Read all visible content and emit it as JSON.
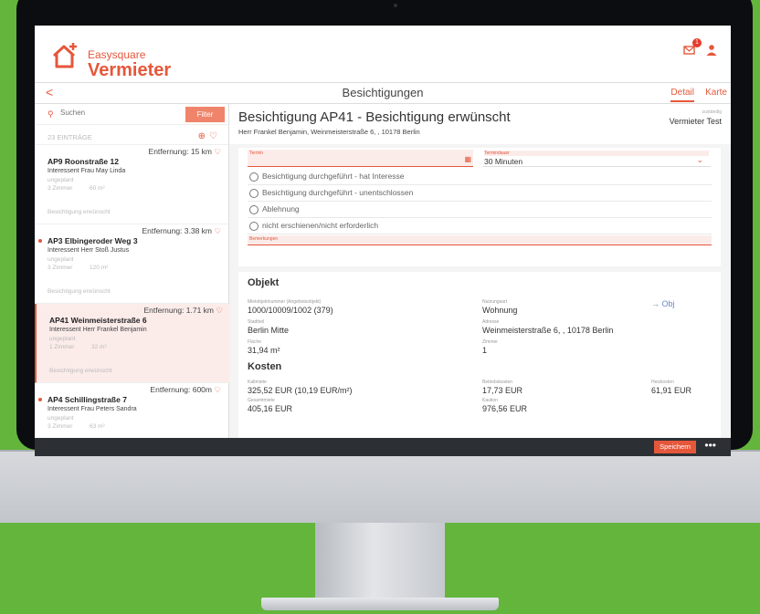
{
  "header": {
    "brand_top": "Easysquare",
    "brand_main": "Vermieter",
    "notification_count": "1"
  },
  "titlebar": {
    "back": "<",
    "title": "Besichtigungen",
    "tab_detail": "Detail",
    "tab_karte": "Karte"
  },
  "sidebar": {
    "search_placeholder": "Suchen",
    "filter_label": "Filter",
    "entries_count": "23 EINTRÄGE",
    "items": [
      {
        "distance": "Entfernung: 15 km",
        "title": "AP9 Roonstraße 12",
        "subtitle": "Interessent Frau May Linda",
        "plan": "ungeplant",
        "rooms": "3 Zimmer",
        "area": "60 m²",
        "status": "Besichtigung erwünscht"
      },
      {
        "distance": "Entfernung: 3.38 km",
        "title": "AP3 Elbingeroder Weg 3",
        "subtitle": "Interessent Herr Stoß Justus",
        "plan": "ungeplant",
        "rooms": "3 Zimmer",
        "area": "120 m²",
        "status": "Besichtigung erwünscht"
      },
      {
        "distance": "Entfernung: 1.71 km",
        "title": "AP41 Weinmeisterstraße 6",
        "subtitle": "Interessent Herr Frankel Benjamin",
        "plan": "ungeplant",
        "rooms": "1 Zimmer",
        "area": "32 m²",
        "status": "Besichtigung erwünscht"
      },
      {
        "distance": "Entfernung: 600m",
        "title": "AP4 Schillingstraße 7",
        "subtitle": "Interessent Frau Peters Sandra",
        "plan": "ungeplant",
        "rooms": "3 Zimmer",
        "area": "63 m²",
        "status": ""
      }
    ]
  },
  "detail": {
    "title": "Besichtigung AP41 - Besichtigung erwünscht",
    "subtitle": "Herr Frankel Benjamin, Weinmeisterstraße 6, , 10178 Berlin",
    "zustaendig_label": "zuständig",
    "zustaendig_value": "Vermieter Test",
    "termin_label": "Termin",
    "dauer_label": "Termindauer",
    "dauer_value": "30 Minuten",
    "options": [
      "Besichtigung durchgeführt - hat Interesse",
      "Besichtigung durchgeführt - unentschlossen",
      "Ablehnung",
      "nicht erschienen/nicht erforderlich"
    ],
    "bemerkungen_label": "Bemerkungen"
  },
  "objekt": {
    "title": "Objekt",
    "link": "→ Obj",
    "mietobjekt_label": "Mietobjektnummer (Angebotsobjekt)",
    "mietobjekt_value": "1000/10009/1002 (379)",
    "nutzungsart_label": "Nutzungsart",
    "nutzungsart_value": "Wohnung",
    "stadtteil_label": "Stadtteil",
    "stadtteil_value": "Berlin Mitte",
    "adresse_label": "Adresse",
    "adresse_value": "Weinmeisterstraße 6, , 10178 Berlin",
    "flaeche_label": "Fläche",
    "flaeche_value": "31,94 m²",
    "zimmer_label": "Zimmer",
    "zimmer_value": "1"
  },
  "kosten": {
    "title": "Kosten",
    "kaltmiete_label": "Kaltmiete",
    "kaltmiete_value": "325,52 EUR (10,19 EUR/m²)",
    "betriebskosten_label": "Betriebskosten",
    "betriebskosten_value": "17,73 EUR",
    "heizkosten_label": "Heizkosten",
    "heizkosten_value": "61,91 EUR",
    "gesamtmiete_label": "Gesamtmiete",
    "gesamtmiete_value": "405,16 EUR",
    "kaution_label": "Kaution",
    "kaution_value": "976,56 EUR"
  },
  "footer": {
    "save_label": "Speichern",
    "more": "•••"
  },
  "colors": {
    "accent": "#e5573b",
    "background": "#63b53c",
    "bar": "#2c3035"
  }
}
